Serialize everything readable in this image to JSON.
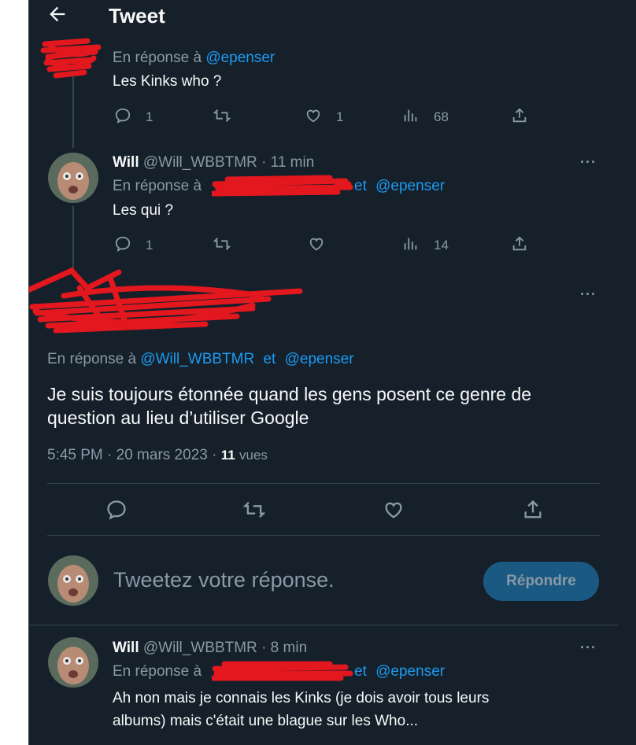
{
  "header": {
    "title": "Tweet"
  },
  "tweet1": {
    "reply_prefix": "En réponse à",
    "reply_to": "@epenser",
    "text": "Les Kinks who ?",
    "replies": "1",
    "likes": "1",
    "views": "68"
  },
  "tweet2": {
    "name": "Will",
    "handle": "@Will_WBBTMR",
    "time": "· 11 min",
    "reply_prefix": "En réponse à",
    "reply_and": "et",
    "reply_to": "@epenser",
    "text": "Les qui ?",
    "replies": "1",
    "views": "14"
  },
  "main_tweet": {
    "reply_prefix": "En réponse à",
    "reply_to_1": "@Will_WBBTMR",
    "reply_and": "et",
    "reply_to_2": "@epenser",
    "text_line1": "Je suis toujours étonnée quand les gens posent ce genre de",
    "text_line2": "question au lieu d’utiliser Google",
    "timestamp": "5:45 PM · 20 mars 2023 ·",
    "views_count": "11",
    "views_label": "vues"
  },
  "composer": {
    "placeholder": "Tweetez votre réponse.",
    "button": "Répondre"
  },
  "tweet3": {
    "name": "Will",
    "handle": "@Will_WBBTMR",
    "time": "· 8 min",
    "reply_prefix": "En réponse à",
    "reply_and": "et",
    "reply_to": "@epenser",
    "text_line1": "Ah non mais je connais les Kinks (je dois avoir tous leurs",
    "text_line2": "albums) mais c'était une blague sur les Who..."
  },
  "icons": [
    "back-arrow-icon",
    "reply-icon",
    "retweet-icon",
    "like-icon",
    "views-icon",
    "share-icon",
    "more-icon"
  ],
  "colors": {
    "background": "#15202b",
    "link": "#1d9bf0",
    "muted": "#8b98a5",
    "redaction": "#e3171e"
  }
}
